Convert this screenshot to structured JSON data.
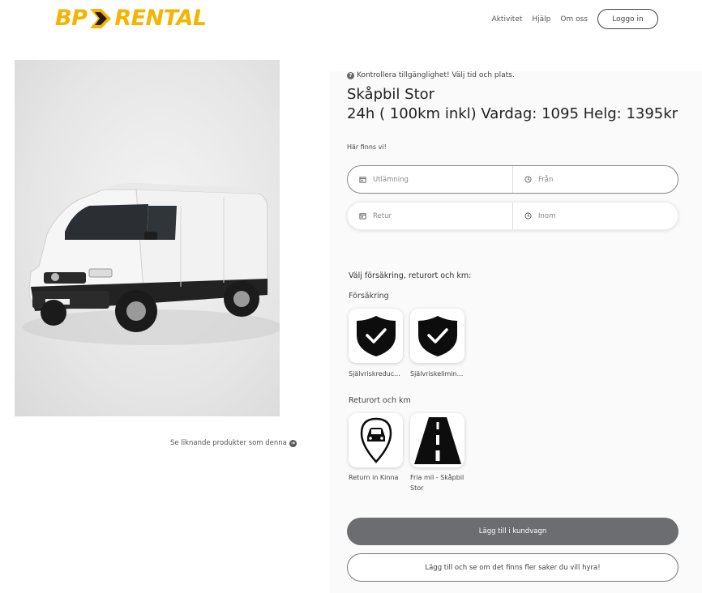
{
  "header": {
    "logo_left": "BP",
    "logo_right": "RENTAL",
    "nav": [
      "Aktivitet",
      "Hjälp",
      "Om oss"
    ],
    "login_label": "Loggo in"
  },
  "product": {
    "availability_note": "Kontrollera tillgänglighet! Välj tid och plats.",
    "title": "Skåpbil Stor",
    "price": "24h ( 100km inkl) Vardag: 1095 Helg: 1395kr",
    "similar_link": "Se liknande produkter som denna"
  },
  "booking": {
    "here_label": "Här finns vi!",
    "pickup_placeholder": "Utlämning",
    "from_placeholder": "Från",
    "return_placeholder": "Retur",
    "within_placeholder": "Inom"
  },
  "options": {
    "heading": "Välj försäkring, returort och km:",
    "insurance_label": "Försäkring",
    "insurance": [
      {
        "label": "Självriskreduc...",
        "icon": "shield-check-icon"
      },
      {
        "label": "Självriskelimin...",
        "icon": "shield-check-icon"
      }
    ],
    "return_label": "Returort och km",
    "return_options": [
      {
        "label": "Return in Kinna",
        "icon": "location-car-icon"
      },
      {
        "label": "Fria mil - Skåpbil Stor",
        "icon": "road-icon"
      }
    ]
  },
  "actions": {
    "add_to_cart": "Lägg till i kundvagn",
    "add_and_continue": "Lägg till och se om det finns fler saker du vill hyra!"
  },
  "colors": {
    "brand_yellow": "#f4b400",
    "brand_dark": "#1a1a1a",
    "primary_button": "#6b6d70"
  }
}
